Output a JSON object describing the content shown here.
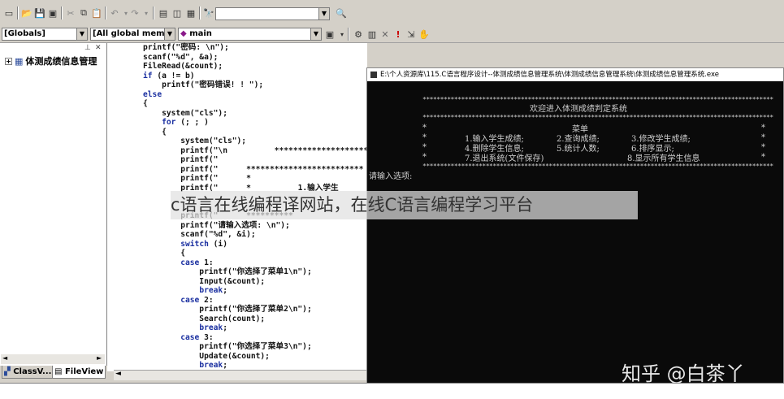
{
  "toolbar": {
    "search_value": "",
    "scope_combo": "[Globals]",
    "members_combo": "[All global members",
    "function_combo": "main"
  },
  "workspace": {
    "tree_root": "体测成绩信息管理",
    "tab_classview": "ClassV...",
    "tab_fileview": "FileView"
  },
  "editor": {
    "lines": [
      "printf(\"密码: \\n\");",
      "scanf(\"%d\", &a);",
      "FileRead(&count);",
      "if (a != b)",
      "    printf(\"密码错误! ! \");",
      "else",
      "{",
      "    system(\"cls\");",
      "    for (; ; )",
      "    {",
      "        system(\"cls\");",
      "        printf(\"\\n          ***************************",
      "        printf(\"",
      "        printf(\"      *************************",
      "        printf(\"      *",
      "        printf(\"      *          1.输入学生",
      "",
      "",
      "        printf(\"      **********",
      "        printf(\"请输入选项: \\n\");",
      "        scanf(\"%d\", &i);",
      "        switch (i)",
      "        {",
      "        case 1:",
      "            printf(\"你选择了菜单1\\n\");",
      "            Input(&count);",
      "            break;",
      "        case 2:",
      "            printf(\"你选择了菜单2\\n\");",
      "            Search(count);",
      "            break;",
      "        case 3:",
      "            printf(\"你选择了菜单3\\n\");",
      "            Update(&count);",
      "            break;"
    ]
  },
  "console": {
    "title": "E:\\个人资源库\\115.C语言程序设计--体测成绩信息管理系统\\体测成绩信息管理系统\\体测成绩信息管理系统.exe",
    "stars_line": "****************************************************************************************************",
    "welcome": "欢迎进入体测成绩判定系统",
    "menu_title": "菜单",
    "item1": "1.输入学生成绩;",
    "item2": "2.查询成绩;",
    "item3": "3.修改学生成绩;",
    "item4": "4.删除学生信息;",
    "item5": "5.统计人数;",
    "item6": "6.排序显示;",
    "item7": "7.退出系统(文件保存)",
    "item8": "8.显示所有学生信息",
    "prompt": "请输入选项:"
  },
  "overlay": {
    "caption": "c语言在线编程译网站，在线C语言编程学习平台",
    "watermark": "知乎 @白茶丫"
  },
  "colors": {
    "chrome": "#d4d0c8",
    "console_bg": "#0a0a0a",
    "console_text": "#cfcfcf",
    "keyword": "#1a2fa0"
  }
}
